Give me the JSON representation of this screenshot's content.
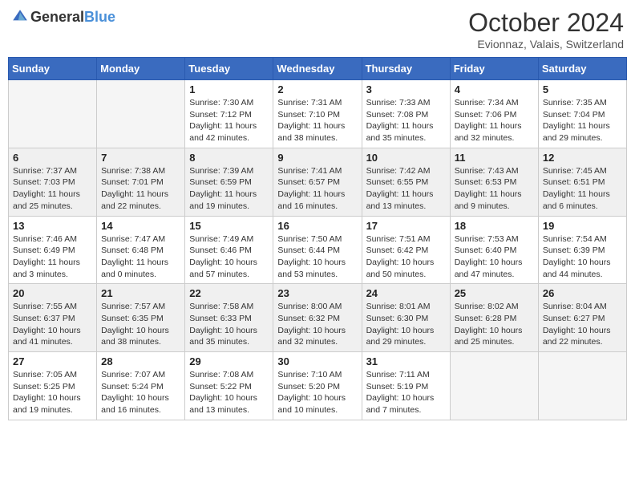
{
  "header": {
    "logo_general": "General",
    "logo_blue": "Blue",
    "month_title": "October 2024",
    "location": "Evionnaz, Valais, Switzerland"
  },
  "weekdays": [
    "Sunday",
    "Monday",
    "Tuesday",
    "Wednesday",
    "Thursday",
    "Friday",
    "Saturday"
  ],
  "weeks": [
    [
      {
        "day": "",
        "sunrise": "",
        "sunset": "",
        "daylight": ""
      },
      {
        "day": "",
        "sunrise": "",
        "sunset": "",
        "daylight": ""
      },
      {
        "day": "1",
        "sunrise": "Sunrise: 7:30 AM",
        "sunset": "Sunset: 7:12 PM",
        "daylight": "Daylight: 11 hours and 42 minutes."
      },
      {
        "day": "2",
        "sunrise": "Sunrise: 7:31 AM",
        "sunset": "Sunset: 7:10 PM",
        "daylight": "Daylight: 11 hours and 38 minutes."
      },
      {
        "day": "3",
        "sunrise": "Sunrise: 7:33 AM",
        "sunset": "Sunset: 7:08 PM",
        "daylight": "Daylight: 11 hours and 35 minutes."
      },
      {
        "day": "4",
        "sunrise": "Sunrise: 7:34 AM",
        "sunset": "Sunset: 7:06 PM",
        "daylight": "Daylight: 11 hours and 32 minutes."
      },
      {
        "day": "5",
        "sunrise": "Sunrise: 7:35 AM",
        "sunset": "Sunset: 7:04 PM",
        "daylight": "Daylight: 11 hours and 29 minutes."
      }
    ],
    [
      {
        "day": "6",
        "sunrise": "Sunrise: 7:37 AM",
        "sunset": "Sunset: 7:03 PM",
        "daylight": "Daylight: 11 hours and 25 minutes."
      },
      {
        "day": "7",
        "sunrise": "Sunrise: 7:38 AM",
        "sunset": "Sunset: 7:01 PM",
        "daylight": "Daylight: 11 hours and 22 minutes."
      },
      {
        "day": "8",
        "sunrise": "Sunrise: 7:39 AM",
        "sunset": "Sunset: 6:59 PM",
        "daylight": "Daylight: 11 hours and 19 minutes."
      },
      {
        "day": "9",
        "sunrise": "Sunrise: 7:41 AM",
        "sunset": "Sunset: 6:57 PM",
        "daylight": "Daylight: 11 hours and 16 minutes."
      },
      {
        "day": "10",
        "sunrise": "Sunrise: 7:42 AM",
        "sunset": "Sunset: 6:55 PM",
        "daylight": "Daylight: 11 hours and 13 minutes."
      },
      {
        "day": "11",
        "sunrise": "Sunrise: 7:43 AM",
        "sunset": "Sunset: 6:53 PM",
        "daylight": "Daylight: 11 hours and 9 minutes."
      },
      {
        "day": "12",
        "sunrise": "Sunrise: 7:45 AM",
        "sunset": "Sunset: 6:51 PM",
        "daylight": "Daylight: 11 hours and 6 minutes."
      }
    ],
    [
      {
        "day": "13",
        "sunrise": "Sunrise: 7:46 AM",
        "sunset": "Sunset: 6:49 PM",
        "daylight": "Daylight: 11 hours and 3 minutes."
      },
      {
        "day": "14",
        "sunrise": "Sunrise: 7:47 AM",
        "sunset": "Sunset: 6:48 PM",
        "daylight": "Daylight: 11 hours and 0 minutes."
      },
      {
        "day": "15",
        "sunrise": "Sunrise: 7:49 AM",
        "sunset": "Sunset: 6:46 PM",
        "daylight": "Daylight: 10 hours and 57 minutes."
      },
      {
        "day": "16",
        "sunrise": "Sunrise: 7:50 AM",
        "sunset": "Sunset: 6:44 PM",
        "daylight": "Daylight: 10 hours and 53 minutes."
      },
      {
        "day": "17",
        "sunrise": "Sunrise: 7:51 AM",
        "sunset": "Sunset: 6:42 PM",
        "daylight": "Daylight: 10 hours and 50 minutes."
      },
      {
        "day": "18",
        "sunrise": "Sunrise: 7:53 AM",
        "sunset": "Sunset: 6:40 PM",
        "daylight": "Daylight: 10 hours and 47 minutes."
      },
      {
        "day": "19",
        "sunrise": "Sunrise: 7:54 AM",
        "sunset": "Sunset: 6:39 PM",
        "daylight": "Daylight: 10 hours and 44 minutes."
      }
    ],
    [
      {
        "day": "20",
        "sunrise": "Sunrise: 7:55 AM",
        "sunset": "Sunset: 6:37 PM",
        "daylight": "Daylight: 10 hours and 41 minutes."
      },
      {
        "day": "21",
        "sunrise": "Sunrise: 7:57 AM",
        "sunset": "Sunset: 6:35 PM",
        "daylight": "Daylight: 10 hours and 38 minutes."
      },
      {
        "day": "22",
        "sunrise": "Sunrise: 7:58 AM",
        "sunset": "Sunset: 6:33 PM",
        "daylight": "Daylight: 10 hours and 35 minutes."
      },
      {
        "day": "23",
        "sunrise": "Sunrise: 8:00 AM",
        "sunset": "Sunset: 6:32 PM",
        "daylight": "Daylight: 10 hours and 32 minutes."
      },
      {
        "day": "24",
        "sunrise": "Sunrise: 8:01 AM",
        "sunset": "Sunset: 6:30 PM",
        "daylight": "Daylight: 10 hours and 29 minutes."
      },
      {
        "day": "25",
        "sunrise": "Sunrise: 8:02 AM",
        "sunset": "Sunset: 6:28 PM",
        "daylight": "Daylight: 10 hours and 25 minutes."
      },
      {
        "day": "26",
        "sunrise": "Sunrise: 8:04 AM",
        "sunset": "Sunset: 6:27 PM",
        "daylight": "Daylight: 10 hours and 22 minutes."
      }
    ],
    [
      {
        "day": "27",
        "sunrise": "Sunrise: 7:05 AM",
        "sunset": "Sunset: 5:25 PM",
        "daylight": "Daylight: 10 hours and 19 minutes."
      },
      {
        "day": "28",
        "sunrise": "Sunrise: 7:07 AM",
        "sunset": "Sunset: 5:24 PM",
        "daylight": "Daylight: 10 hours and 16 minutes."
      },
      {
        "day": "29",
        "sunrise": "Sunrise: 7:08 AM",
        "sunset": "Sunset: 5:22 PM",
        "daylight": "Daylight: 10 hours and 13 minutes."
      },
      {
        "day": "30",
        "sunrise": "Sunrise: 7:10 AM",
        "sunset": "Sunset: 5:20 PM",
        "daylight": "Daylight: 10 hours and 10 minutes."
      },
      {
        "day": "31",
        "sunrise": "Sunrise: 7:11 AM",
        "sunset": "Sunset: 5:19 PM",
        "daylight": "Daylight: 10 hours and 7 minutes."
      },
      {
        "day": "",
        "sunrise": "",
        "sunset": "",
        "daylight": ""
      },
      {
        "day": "",
        "sunrise": "",
        "sunset": "",
        "daylight": ""
      }
    ]
  ]
}
